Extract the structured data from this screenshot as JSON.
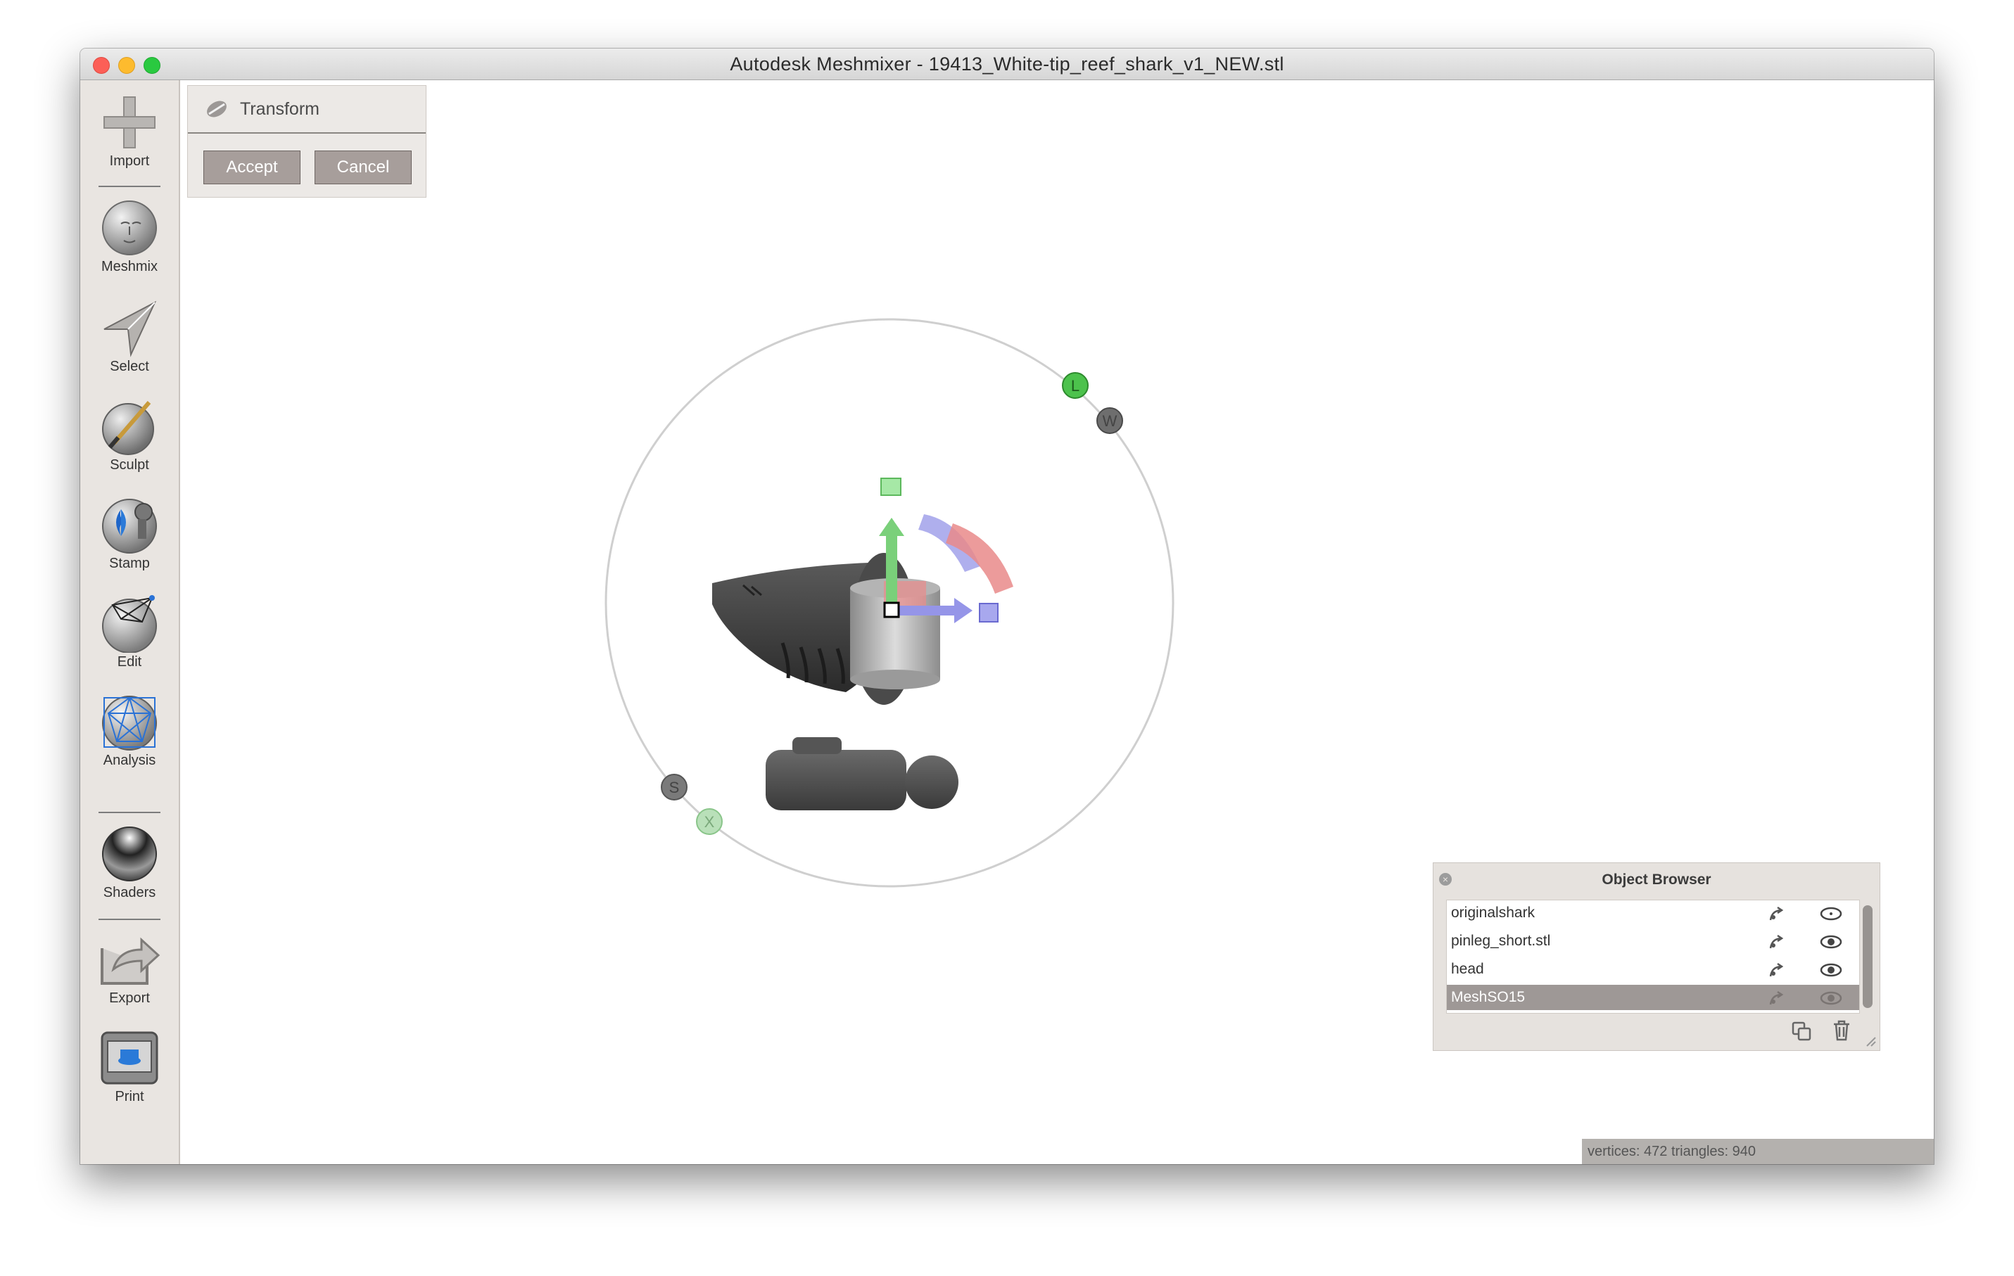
{
  "window": {
    "title": "Autodesk Meshmixer - 19413_White-tip_reef_shark_v1_NEW.stl"
  },
  "toolbar": {
    "items": [
      {
        "label": "Import",
        "icon": "plus-icon"
      },
      {
        "label": "Meshmix",
        "icon": "meshmix-head-icon"
      },
      {
        "label": "Select",
        "icon": "select-arrow-icon"
      },
      {
        "label": "Sculpt",
        "icon": "sculpt-brush-icon"
      },
      {
        "label": "Stamp",
        "icon": "stamp-icon"
      },
      {
        "label": "Edit",
        "icon": "edit-icon"
      },
      {
        "label": "Analysis",
        "icon": "analysis-mesh-icon"
      },
      {
        "label": "Shaders",
        "icon": "shader-sphere-icon"
      },
      {
        "label": "Export",
        "icon": "export-icon"
      },
      {
        "label": "Print",
        "icon": "printer-icon"
      }
    ]
  },
  "transform_panel": {
    "title": "Transform",
    "accept_label": "Accept",
    "cancel_label": "Cancel"
  },
  "gizmo": {
    "handle_labels": {
      "local": "L",
      "world": "W",
      "scale": "S",
      "axis": "X"
    }
  },
  "object_browser": {
    "title": "Object Browser",
    "items": [
      {
        "label": "originalshark",
        "selected": false
      },
      {
        "label": "pinleg_short.stl",
        "selected": false
      },
      {
        "label": "head",
        "selected": false
      },
      {
        "label": "MeshSO15",
        "selected": true
      }
    ]
  },
  "status": {
    "text": "vertices: 472 triangles: 940"
  },
  "colors": {
    "toolbar_bg": "#e9e5e1",
    "button_bg": "#a79e9b",
    "selected_row": "#9e9896",
    "gizmo_green": "#4cc24c",
    "gizmo_red": "#e86a6a",
    "gizmo_blue": "#8a8ae8"
  }
}
